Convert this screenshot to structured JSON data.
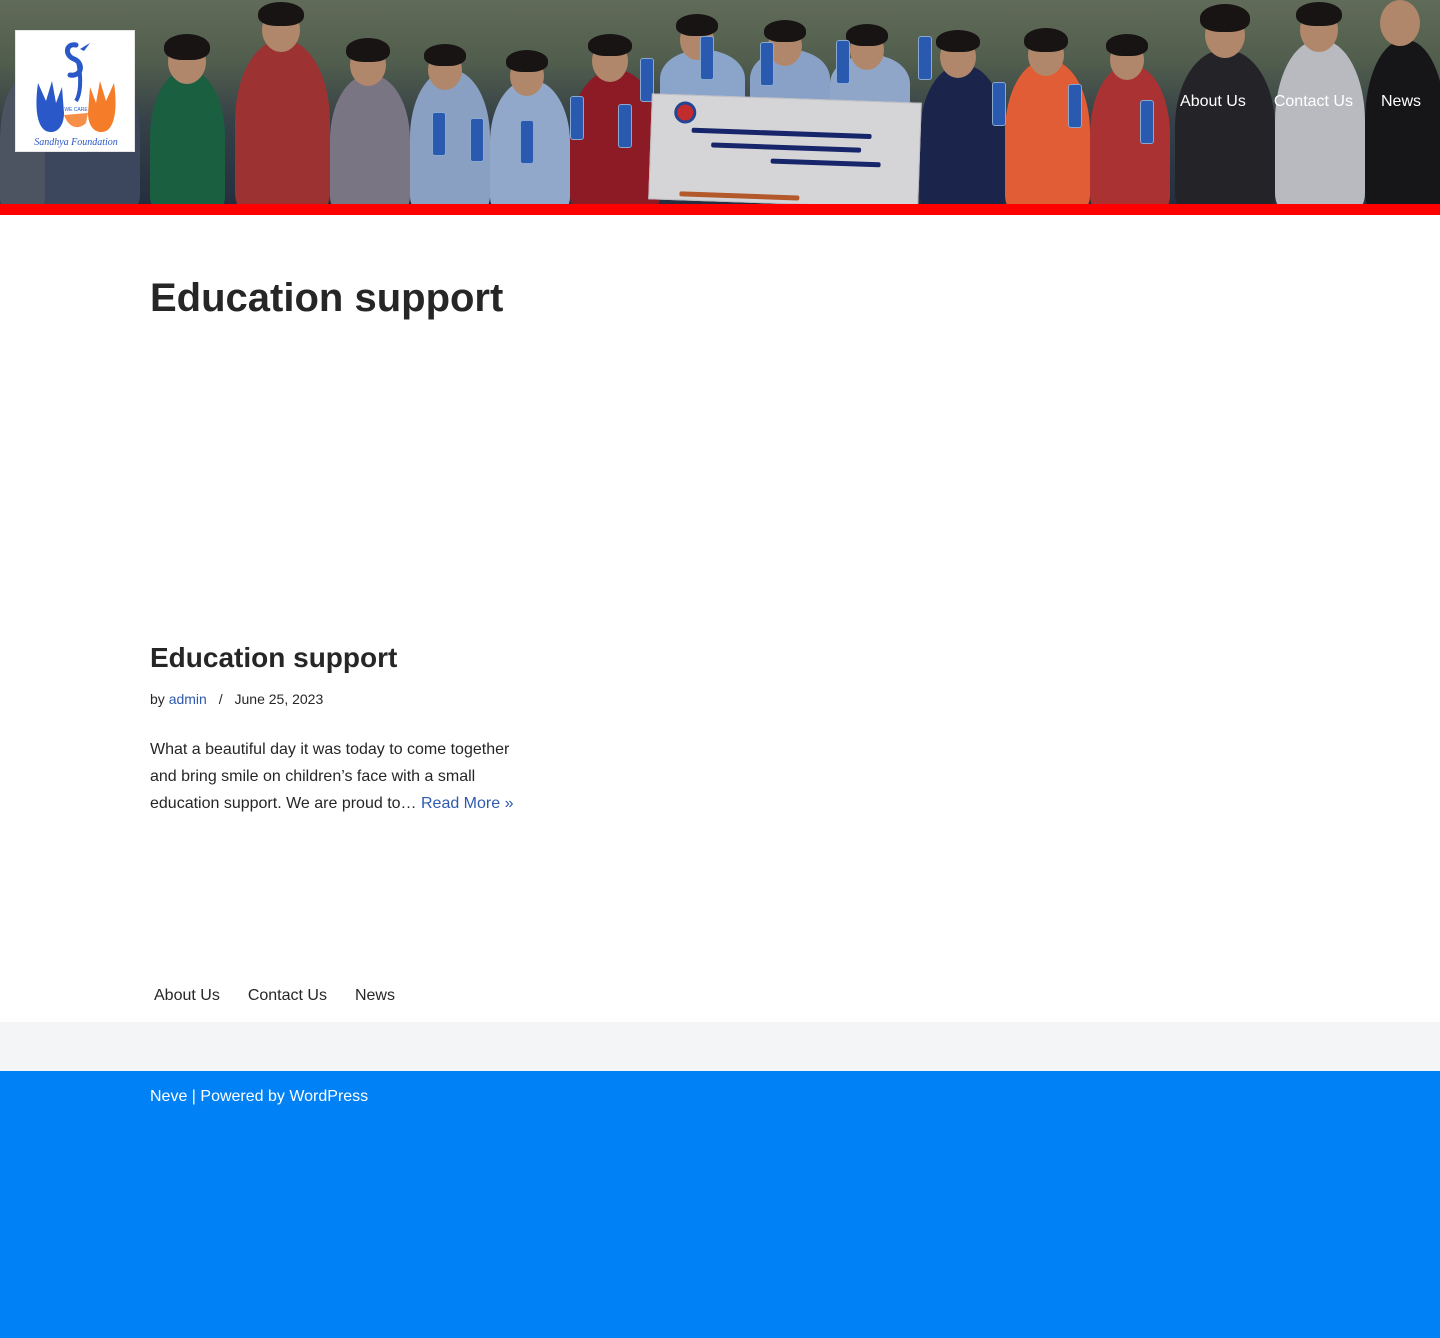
{
  "header": {
    "logo_alt": "Sandhya Foundation",
    "logo_text": "Sandhya Foundation",
    "logo_tagline": "WE CARE",
    "nav": [
      {
        "label": "About Us"
      },
      {
        "label": "Contact Us"
      },
      {
        "label": "News"
      }
    ],
    "accent_band_color": "#ff0000"
  },
  "main": {
    "page_title": "Education support",
    "post": {
      "title": "Education support",
      "by_label": "by",
      "author": "admin",
      "separator": "/",
      "date": "June 25, 2023",
      "excerpt": "What a beautiful day it was today to come together and bring smile on children’s face with a small education support. We are proud to…",
      "read_more": "Read More »"
    }
  },
  "footer": {
    "nav": [
      {
        "label": "About Us"
      },
      {
        "label": "Contact Us"
      },
      {
        "label": "News"
      }
    ],
    "theme_link": "Neve",
    "powered_by": " | Powered by ",
    "cms_link": "WordPress",
    "bottom_color": "#0081f5",
    "top_color": "#f4f5f7"
  }
}
